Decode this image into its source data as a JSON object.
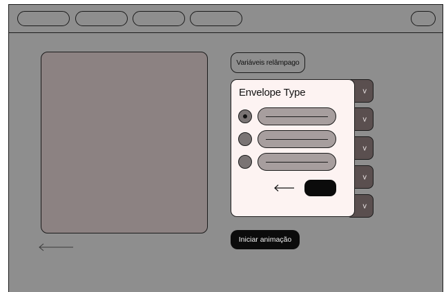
{
  "topbar": {
    "tabs": [
      "",
      "",
      "",
      ""
    ],
    "right_button": ""
  },
  "flash_variables_chip": "Variáveis relâmpago",
  "envelope_panel": {
    "title": "Envelope Type",
    "options": [
      {
        "selected": true
      },
      {
        "selected": false
      },
      {
        "selected": false
      }
    ],
    "back_icon": "arrow-left-icon",
    "confirm_label": ""
  },
  "dropdowns": [
    {
      "chevron": "v"
    },
    {
      "chevron": "v"
    },
    {
      "chevron": "v"
    },
    {
      "chevron": "v"
    },
    {
      "chevron": "v"
    }
  ],
  "start_animation_button": "Iniciar animação",
  "colors": {
    "background": "#8e8e8e",
    "panel": "#fdf3f2",
    "preview": "#8c8282",
    "field": "#a79e9e",
    "dark_button": "#0b0b0b",
    "dropdown": "#5a4f4f"
  }
}
